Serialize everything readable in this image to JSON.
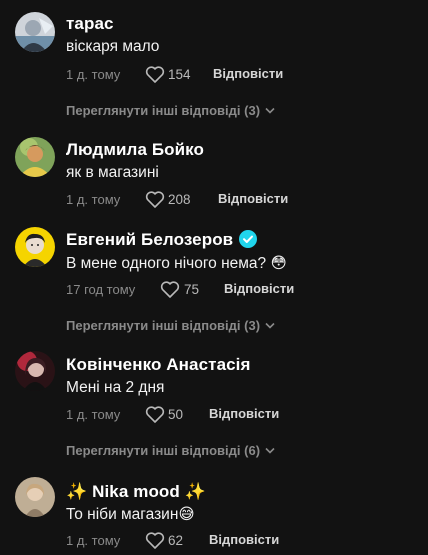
{
  "comments": [
    {
      "name": "тарас",
      "text": "віскаря мало",
      "time": "1 д. тому",
      "likes": "154",
      "reply": "Відповісти",
      "view_replies": "Переглянути інші відповіді (3)"
    },
    {
      "name": "Людмила Бойко",
      "text": "як в магазині",
      "time": "1 д. тому",
      "likes": "208",
      "reply": "Відповісти"
    },
    {
      "name": "Евгений Белозеров",
      "text": "В мене одного нічого нема? 😳",
      "time": "17 год тому",
      "likes": "75",
      "reply": "Відповісти",
      "view_replies": "Переглянути інші відповіді (3)"
    },
    {
      "name": "Ковінченко Анастасія",
      "text": "Мені на 2 дня",
      "time": "1 д. тому",
      "likes": "50",
      "reply": "Відповісти",
      "view_replies": "Переглянути інші відповіді (6)"
    },
    {
      "name_prefix": "✨",
      "name_main": " Nika mood ",
      "name_suffix": "✨",
      "text": "То ніби магазин😅",
      "time": "1 д. тому",
      "likes": "62",
      "reply": "Відповісти"
    }
  ],
  "icons": {
    "like": "heart-outline-icon",
    "verified": "verified-badge-icon",
    "expand": "chevron-down-icon"
  },
  "colors": {
    "background": "#121212",
    "verified": "#20d5ec",
    "muted": "#8a8a8a"
  }
}
